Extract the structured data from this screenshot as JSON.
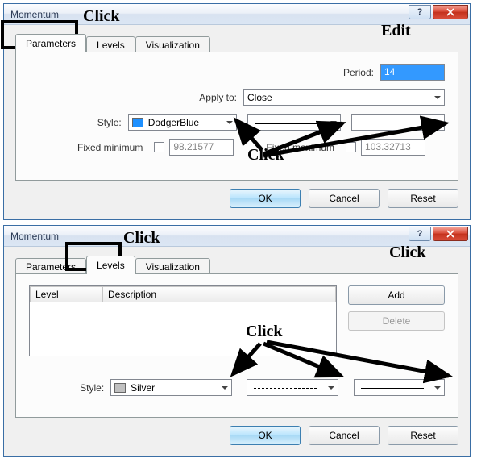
{
  "dialog1": {
    "title": "Momentum",
    "tabs": {
      "parameters": "Parameters",
      "levels": "Levels",
      "visualization": "Visualization"
    },
    "period_label": "Period:",
    "period_value": "14",
    "apply_label": "Apply to:",
    "apply_value": "Close",
    "style_label": "Style:",
    "style_color_name": "DodgerBlue",
    "style_color_hex": "#1e90ff",
    "fixed_min_label": "Fixed minimum",
    "fixed_min_value": "98.21577",
    "fixed_max_label": "Fixed maximum",
    "fixed_max_value": "103.32713",
    "ok": "OK",
    "cancel": "Cancel",
    "reset": "Reset"
  },
  "dialog2": {
    "title": "Momentum",
    "tabs": {
      "parameters": "Parameters",
      "levels": "Levels",
      "visualization": "Visualization"
    },
    "col_level": "Level",
    "col_desc": "Description",
    "add": "Add",
    "delete": "Delete",
    "style_label": "Style:",
    "style_color_name": "Silver",
    "style_color_hex": "#c0c0c0",
    "ok": "OK",
    "cancel": "Cancel",
    "reset": "Reset"
  },
  "annotations": {
    "click": "Click",
    "edit": "Edit"
  }
}
